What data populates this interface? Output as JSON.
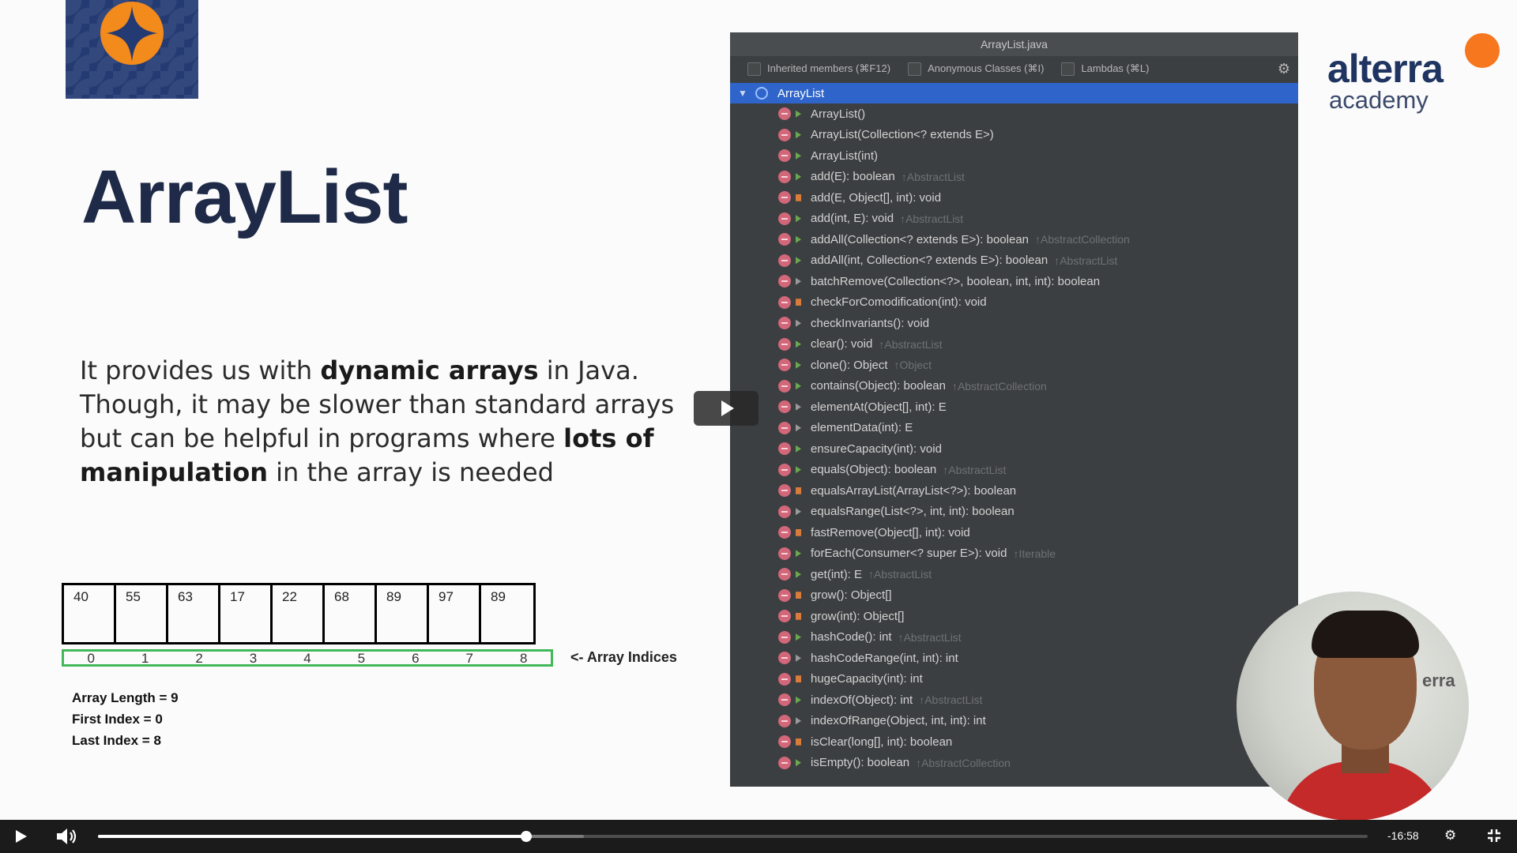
{
  "slide": {
    "title": "ArrayList",
    "description": {
      "p1": "It provides us with ",
      "b1": "dynamic arrays",
      "p2": " in Java. Though, it may be slower than standard arrays but can be helpful in programs where ",
      "b2": "lots of manipulation",
      "p3": " in the array is needed"
    },
    "array": {
      "values": [
        "40",
        "55",
        "63",
        "17",
        "22",
        "68",
        "89",
        "97",
        "89"
      ],
      "indices": [
        "0",
        "1",
        "2",
        "3",
        "4",
        "5",
        "6",
        "7",
        "8"
      ],
      "indices_label": "<- Array Indices",
      "facts": [
        "Array Length = 9",
        "First Index = 0",
        "Last Index = 8"
      ]
    },
    "brand": {
      "word1": "alterra",
      "word2": "academy",
      "dot_color": "#f7771f"
    }
  },
  "ide": {
    "title": "ArrayList.java",
    "options": [
      "Inherited members (⌘F12)",
      "Anonymous Classes (⌘I)",
      "Lambdas (⌘L)"
    ],
    "root": "ArrayList",
    "members": [
      {
        "sig": "ArrayList()",
        "vis": "pub",
        "inherited": ""
      },
      {
        "sig": "ArrayList(Collection<? extends E>)",
        "vis": "pub",
        "inherited": ""
      },
      {
        "sig": "ArrayList(int)",
        "vis": "pub",
        "inherited": ""
      },
      {
        "sig": "add(E): boolean",
        "vis": "pub",
        "inherited": "↑AbstractList"
      },
      {
        "sig": "add(E, Object[], int): void",
        "vis": "priv",
        "inherited": ""
      },
      {
        "sig": "add(int, E): void",
        "vis": "pub",
        "inherited": "↑AbstractList"
      },
      {
        "sig": "addAll(Collection<? extends E>): boolean",
        "vis": "pub",
        "inherited": "↑AbstractCollection"
      },
      {
        "sig": "addAll(int, Collection<? extends E>): boolean",
        "vis": "pub",
        "inherited": "↑AbstractList"
      },
      {
        "sig": "batchRemove(Collection<?>, boolean, int, int): boolean",
        "vis": "pkg",
        "inherited": ""
      },
      {
        "sig": "checkForComodification(int): void",
        "vis": "priv",
        "inherited": ""
      },
      {
        "sig": "checkInvariants(): void",
        "vis": "pkg",
        "inherited": ""
      },
      {
        "sig": "clear(): void",
        "vis": "pub",
        "inherited": "↑AbstractList"
      },
      {
        "sig": "clone(): Object",
        "vis": "pub",
        "inherited": "↑Object"
      },
      {
        "sig": "contains(Object): boolean",
        "vis": "pub",
        "inherited": "↑AbstractCollection"
      },
      {
        "sig": "elementAt(Object[], int): E",
        "vis": "pkg",
        "inherited": ""
      },
      {
        "sig": "elementData(int): E",
        "vis": "pkg",
        "inherited": ""
      },
      {
        "sig": "ensureCapacity(int): void",
        "vis": "pub",
        "inherited": ""
      },
      {
        "sig": "equals(Object): boolean",
        "vis": "pub",
        "inherited": "↑AbstractList"
      },
      {
        "sig": "equalsArrayList(ArrayList<?>): boolean",
        "vis": "priv",
        "inherited": ""
      },
      {
        "sig": "equalsRange(List<?>, int, int): boolean",
        "vis": "pkg",
        "inherited": ""
      },
      {
        "sig": "fastRemove(Object[], int): void",
        "vis": "priv",
        "inherited": ""
      },
      {
        "sig": "forEach(Consumer<? super E>): void",
        "vis": "pub",
        "inherited": "↑Iterable"
      },
      {
        "sig": "get(int): E",
        "vis": "pub",
        "inherited": "↑AbstractList"
      },
      {
        "sig": "grow(): Object[]",
        "vis": "priv",
        "inherited": ""
      },
      {
        "sig": "grow(int): Object[]",
        "vis": "priv",
        "inherited": ""
      },
      {
        "sig": "hashCode(): int",
        "vis": "pub",
        "inherited": "↑AbstractList"
      },
      {
        "sig": "hashCodeRange(int, int): int",
        "vis": "pkg",
        "inherited": ""
      },
      {
        "sig": "hugeCapacity(int): int",
        "vis": "priv",
        "inherited": ""
      },
      {
        "sig": "indexOf(Object): int",
        "vis": "pub",
        "inherited": "↑AbstractList"
      },
      {
        "sig": "indexOfRange(Object, int, int): int",
        "vis": "pkg",
        "inherited": ""
      },
      {
        "sig": "isClear(long[], int): boolean",
        "vis": "priv",
        "inherited": ""
      },
      {
        "sig": "isEmpty(): boolean",
        "vis": "pub",
        "inherited": "↑AbstractCollection"
      }
    ]
  },
  "player": {
    "time_remaining": "-16:58",
    "progress": 0.337,
    "buffered": 0.383
  }
}
